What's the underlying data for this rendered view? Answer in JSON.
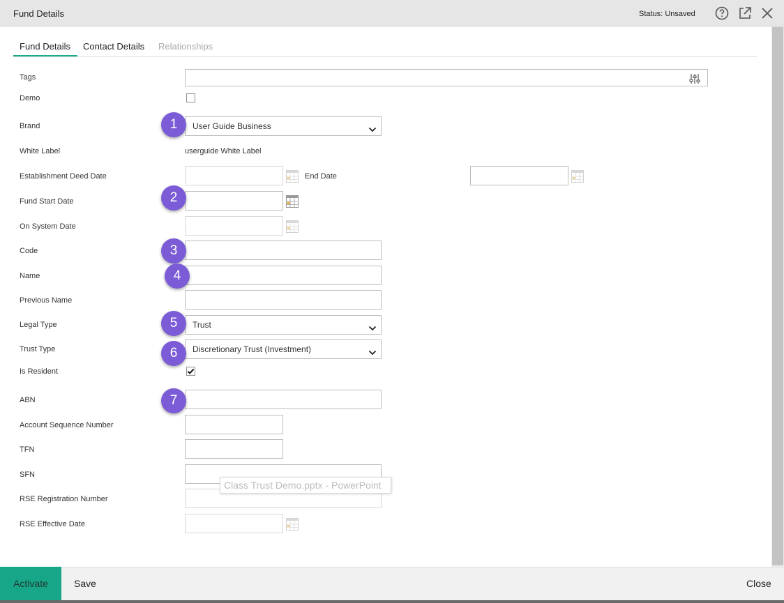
{
  "header": {
    "title": "Fund Details",
    "status_label": "Status:",
    "status_value": "Unsaved",
    "icons": [
      "help-circle-icon",
      "popout-icon",
      "close-icon"
    ]
  },
  "tabs": [
    {
      "label": "Fund Details",
      "active": true
    },
    {
      "label": "Contact Details",
      "active": false
    },
    {
      "label": "Relationships",
      "active": false,
      "disabled": true
    }
  ],
  "form": {
    "tags": {
      "label": "Tags",
      "value": ""
    },
    "demo": {
      "label": "Demo",
      "checked": false
    },
    "brand": {
      "label": "Brand",
      "value": "User Guide Business"
    },
    "white_label": {
      "label": "White Label",
      "value": "userguide White Label"
    },
    "establishment_deed_date": {
      "label": "Establishment Deed Date",
      "value": ""
    },
    "end_date": {
      "label": "End Date",
      "value": ""
    },
    "fund_start_date": {
      "label": "Fund Start Date",
      "value": ""
    },
    "on_system_date": {
      "label": "On System Date",
      "value": ""
    },
    "code": {
      "label": "Code",
      "value": ""
    },
    "name": {
      "label": "Name",
      "value": ""
    },
    "previous_name": {
      "label": "Previous Name",
      "value": ""
    },
    "legal_type": {
      "label": "Legal Type",
      "value": "Trust"
    },
    "trust_type": {
      "label": "Trust Type",
      "value": "Discretionary Trust (Investment)"
    },
    "is_resident": {
      "label": "Is Resident",
      "checked": true
    },
    "abn": {
      "label": "ABN",
      "value": ""
    },
    "account_sequence_number": {
      "label": "Account Sequence Number",
      "value": ""
    },
    "tfn": {
      "label": "TFN",
      "value": ""
    },
    "sfn": {
      "label": "SFN",
      "value": ""
    },
    "rse_registration_number": {
      "label": "RSE Registration Number",
      "value": ""
    },
    "rse_effective_date": {
      "label": "RSE Effective Date",
      "value": ""
    }
  },
  "badges": [
    "1",
    "2",
    "3",
    "4",
    "5",
    "6",
    "7"
  ],
  "tooltip": "Class Trust Demo.pptx - PowerPoint",
  "footer": {
    "activate_label": "Activate",
    "save_label": "Save",
    "close_label": "Close"
  },
  "colors": {
    "accent": "#18a689",
    "badge": "#7b5cd6",
    "titlebar": "#e6e6e6"
  }
}
